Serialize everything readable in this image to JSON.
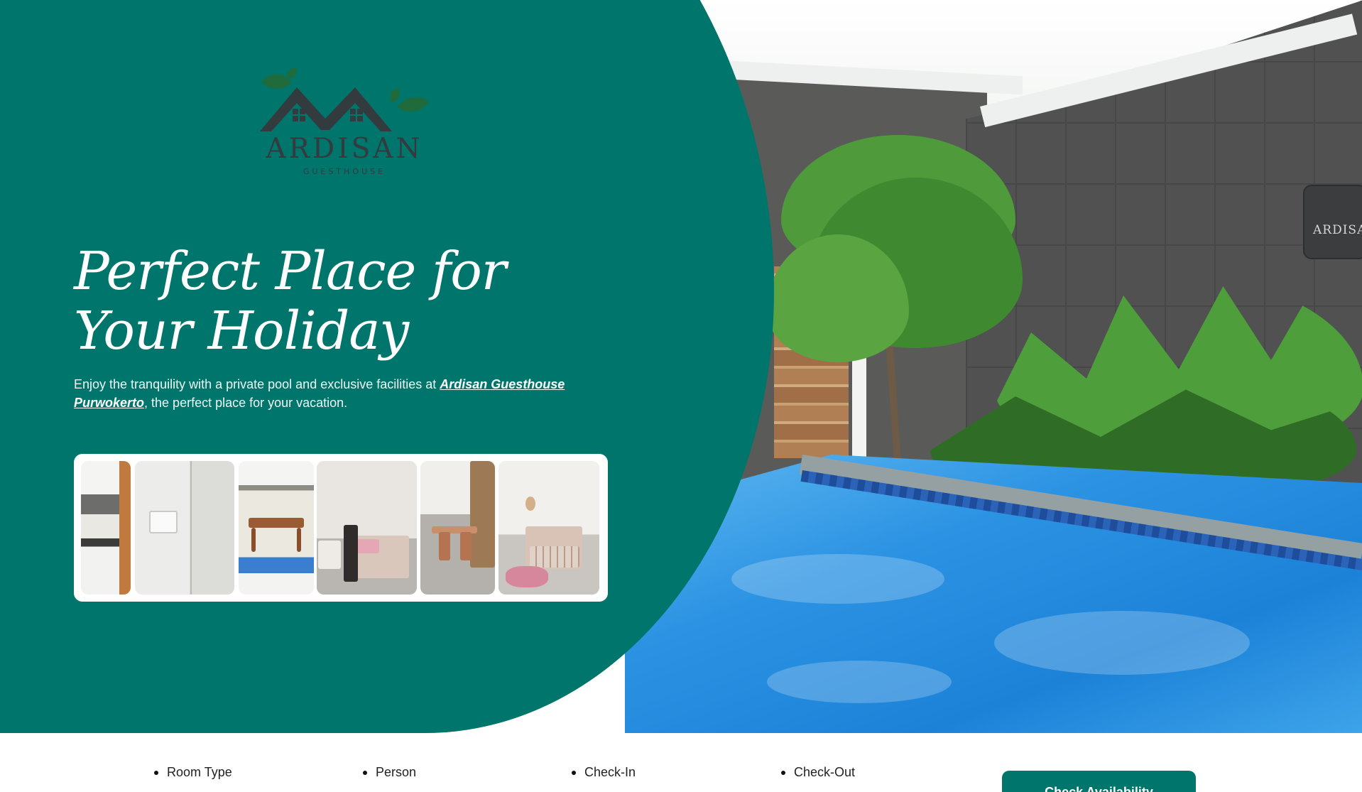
{
  "brand": {
    "name": "ARDISAN",
    "subtitle": "GUESTHOUSE",
    "colors": {
      "primary": "#00756b",
      "logo_dark": "#333b3f",
      "leaf": "#1f6b3b"
    }
  },
  "hero": {
    "headline": "Perfect Place for Your Holiday",
    "tagline_before": "Enjoy the tranquility with a private pool and exclusive facilities at ",
    "tagline_link": "Ardisan Guesthouse Purwokerto",
    "tagline_after": ", the perfect place for your vacation."
  },
  "gallery": {
    "images": [
      "kitchen",
      "bathroom",
      "dining-pool-view",
      "bedroom-1",
      "dining-room",
      "bedroom-2"
    ]
  },
  "booking": {
    "fields": [
      {
        "label": "Room Type"
      },
      {
        "label": "Person"
      },
      {
        "label": "Check-In"
      },
      {
        "label": "Check-Out"
      }
    ],
    "button_label": "Check Availability"
  }
}
